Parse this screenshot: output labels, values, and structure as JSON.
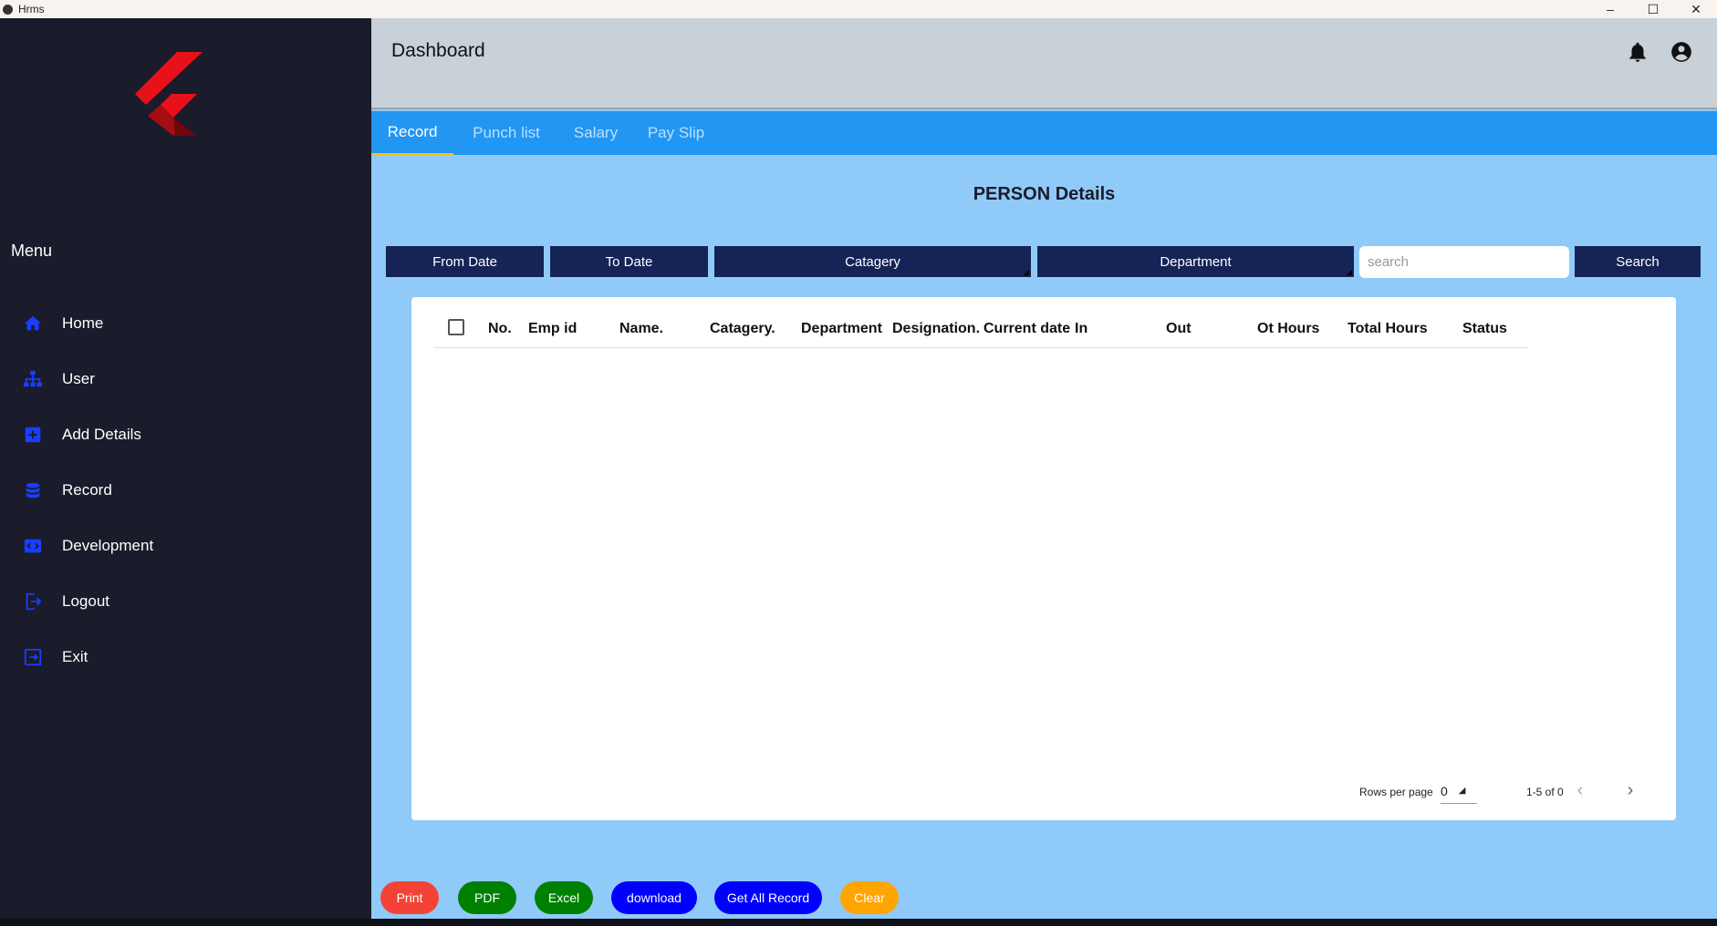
{
  "window": {
    "title": "Hrms",
    "minimize": "–",
    "maximize": "☐",
    "close": "✕"
  },
  "sidebar": {
    "menu_title": "Menu",
    "items": [
      {
        "label": "Home",
        "icon": "home-icon"
      },
      {
        "label": "User",
        "icon": "org-chart-icon"
      },
      {
        "label": "Add Details",
        "icon": "add-box-icon"
      },
      {
        "label": "Record",
        "icon": "database-icon"
      },
      {
        "label": "Development",
        "icon": "code-window-icon"
      },
      {
        "label": "Logout",
        "icon": "logout-icon"
      },
      {
        "label": "Exit",
        "icon": "exit-icon"
      }
    ]
  },
  "header": {
    "title": "Dashboard",
    "icons": [
      "bell-icon",
      "account-circle-icon"
    ]
  },
  "tabs": [
    {
      "label": "Record",
      "active": true
    },
    {
      "label": "Punch list",
      "active": false
    },
    {
      "label": "Salary",
      "active": false
    },
    {
      "label": "Pay Slip",
      "active": false
    }
  ],
  "section_title": "PERSON Details",
  "filters": {
    "from_date": "From Date",
    "to_date": "To Date",
    "category": "Catagery",
    "department": "Department",
    "search_placeholder": "search",
    "search_button": "Search"
  },
  "table": {
    "columns": [
      "No.",
      "Emp id",
      "Name.",
      "Catagery.",
      "Department",
      "Designation.",
      "Current date",
      "In",
      "Out",
      "Ot Hours",
      "Total Hours",
      "Status"
    ],
    "rows": []
  },
  "pagination": {
    "rows_per_page_label": "Rows per page",
    "rows_per_page_value": "0",
    "range": "1-5 of 0"
  },
  "actions": [
    {
      "label": "Print",
      "color": "#f44336"
    },
    {
      "label": "PDF",
      "color": "#008000"
    },
    {
      "label": "Excel",
      "color": "#008000"
    },
    {
      "label": "download",
      "color": "#0000ff"
    },
    {
      "label": "Get All Record",
      "color": "#0000ff"
    },
    {
      "label": "Clear",
      "color": "#ffa500"
    }
  ],
  "colors": {
    "sidebar_bg": "#1a1b2b",
    "appbar_bg": "#c8d0d8",
    "tabbar_bg": "#2196f3",
    "content_bg": "#90caf9",
    "filter_bg": "#152356",
    "tab_indicator": "#ffc107",
    "menu_icon": "#1a3dff"
  }
}
